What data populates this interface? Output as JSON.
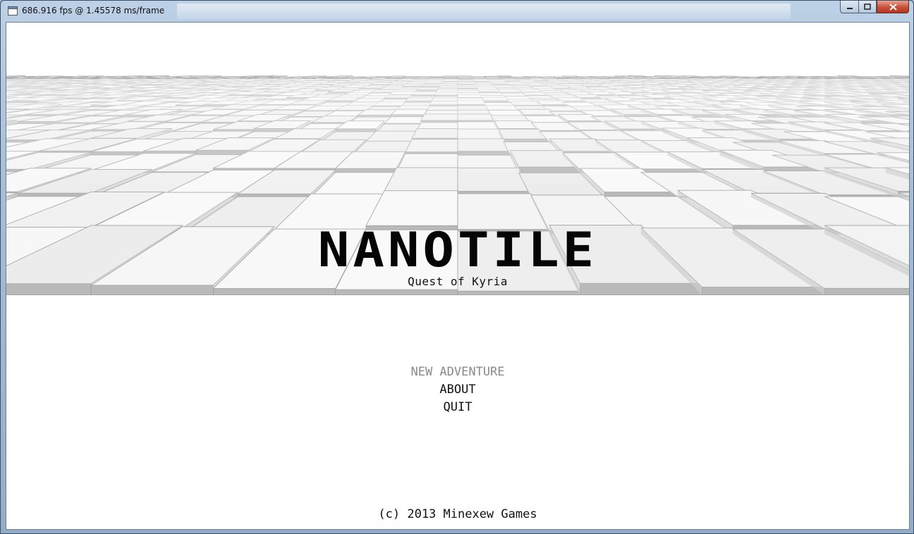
{
  "window": {
    "title": "686.916 fps @ 1.45578 ms/frame",
    "controls": {
      "minimize_icon": "minimize-icon",
      "maximize_icon": "maximize-icon",
      "close_icon": "close-icon"
    }
  },
  "game": {
    "title": "NANOTILE",
    "subtitle": "Quest of Kyria",
    "menu": [
      {
        "label": "NEW ADVENTURE",
        "selected": true
      },
      {
        "label": "ABOUT",
        "selected": false
      },
      {
        "label": "QUIT",
        "selected": false
      }
    ],
    "copyright": "(c) 2013 Minexew Games"
  },
  "colors": {
    "sky": "#ffffff",
    "tile_light": "#f3f3f3",
    "tile_dark": "#9a9a9a",
    "menu_selected": "#8a8a8a",
    "text": "#111111"
  }
}
